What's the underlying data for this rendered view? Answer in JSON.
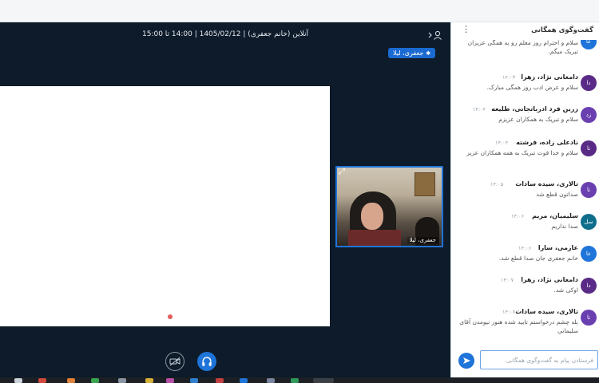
{
  "stage": {
    "title": "آنلاین (خانم جعفری) | 1405/02/12 | 14:00 تا 15:00",
    "presenter_badge": "جعفری، لیلا",
    "webcam_label": "جعفری، لیلا"
  },
  "chat": {
    "title": "گفت‌وگوی همگانی",
    "input_placeholder": "فرستادن پیام به گفت‌وگوی همگانی",
    "messages": [
      {
        "name": "",
        "time": "",
        "initials": "عا",
        "avatar_color": "#1e74d8",
        "text": "سلام و احترام روز معلم رو به همگی عزیزان تبریک میگم."
      },
      {
        "name": "دامغانی نژاد، زهرا",
        "time": "۱۴:۰۳",
        "initials": "دا",
        "avatar_color": "#5a2a87",
        "text": "سلام و عرض ادب روز همگی مبارک."
      },
      {
        "name": "زرین فرد ادرباتجانی، طلیعه",
        "time": "۱۴:۰۴",
        "initials": "زد",
        "avatar_color": "#6a3fb0",
        "text": "سلام و تبریک به همکاران عزیزم"
      },
      {
        "name": "نادعلی زاده، فرشته",
        "time": "۱۴:۰۴",
        "initials": "نا",
        "avatar_color": "#5a2a87",
        "text": "سلام و خدا قوت تبریک به همه همکاران عزیز"
      },
      {
        "name": "تالاری، سیده سادات",
        "time": "۱۴:۰۵",
        "initials": "تا",
        "avatar_color": "#6a3fb0",
        "text": "صداتون قطع شد"
      },
      {
        "name": "سلیمیان، مریم",
        "time": "۱۴:۰۶",
        "initials": "سل",
        "avatar_color": "#0f6e8c",
        "text": "صدا نداریم"
      },
      {
        "name": "عازمی، سارا",
        "time": "۱۴:۰۶",
        "initials": "عا",
        "avatar_color": "#1e74d8",
        "text": "خانم جعفری جان صدا قطع شد."
      },
      {
        "name": "دامغانی نژاد، زهرا",
        "time": "۱۴:۰۷",
        "initials": "دا",
        "avatar_color": "#5a2a87",
        "text": "اوکی شد."
      },
      {
        "name": "تالاری، سیده سادات",
        "time": "۱۴:۰۷",
        "initials": "تا",
        "avatar_color": "#6a3fb0",
        "text": "بله چشم درخواستم تایید شده هنوز نیومدن آقای سلیمانی"
      }
    ]
  },
  "controls": {
    "camera_icon": "camera-off-icon",
    "audio_icon": "headphones-icon"
  },
  "colors": {
    "stage_bg": "#0d1b2a",
    "accent": "#1e74d8",
    "recording_dot": "#e35d5d"
  }
}
